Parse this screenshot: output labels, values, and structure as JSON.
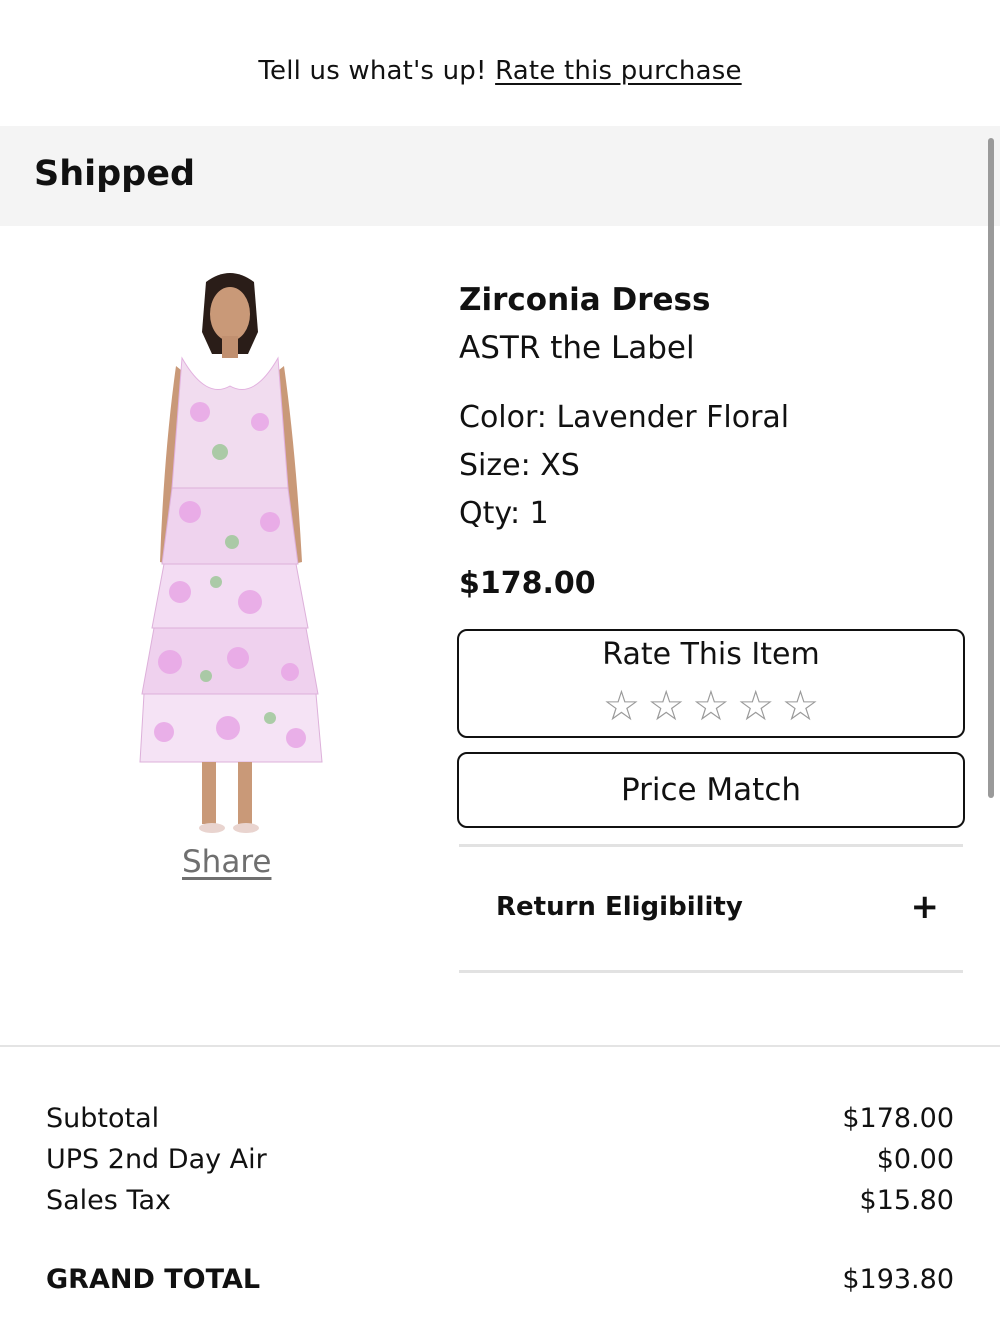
{
  "banner": {
    "prompt": "Tell us what's up!",
    "link": "Rate this purchase"
  },
  "order": {
    "status": "Shipped"
  },
  "item": {
    "name": "Zirconia Dress",
    "brand": "ASTR the Label",
    "color": "Color: Lavender Floral",
    "size": "Size: XS",
    "qty": "Qty: 1",
    "price": "$178.00",
    "share_label": "Share",
    "rate_label": "Rate This Item",
    "star_glyph": "☆",
    "rating": 0,
    "max_rating": 5,
    "price_match_label": "Price Match",
    "return_label": "Return Eligibility",
    "expand_glyph": "+",
    "dress_colors": {
      "lavender": "#e8a6e6",
      "light": "#f6e8f6",
      "leaf": "#9fc89a"
    }
  },
  "summary": {
    "rows": [
      {
        "label": "Subtotal",
        "value": "$178.00"
      },
      {
        "label": "UPS 2nd Day Air",
        "value": "$0.00"
      },
      {
        "label": "Sales Tax",
        "value": "$15.80"
      }
    ],
    "total_label": "GRAND TOTAL",
    "total_value": "$193.80"
  }
}
